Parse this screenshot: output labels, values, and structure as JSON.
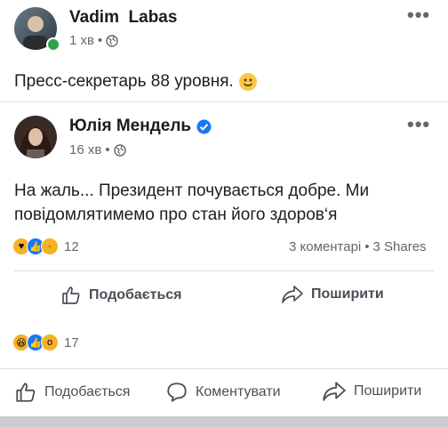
{
  "post": {
    "author": "Vadim  Labas",
    "time": "1 хв",
    "text": "Пресс-секретарь 88 уровня."
  },
  "shared": {
    "author": "Юлія Мендель",
    "time": "16 хв",
    "text_line1": "На жаль... Президент почувається добре. Ми",
    "text_line2": "повідомлятимемо про стан його здоров‘я",
    "reactions_count": "12",
    "comments": "3 коментарі",
    "shares": "3 Shares",
    "like_label": "Подобається",
    "share_label": "Поширити"
  },
  "footer": {
    "reactions_count": "17",
    "like_label": "Подобається",
    "comment_label": "Коментувати",
    "share_label": "Поширити"
  },
  "colors": {
    "verified": "#1877f2",
    "online": "#31a24c",
    "like_blue": "#1877f2",
    "haha_yellow": "#f7b125"
  }
}
